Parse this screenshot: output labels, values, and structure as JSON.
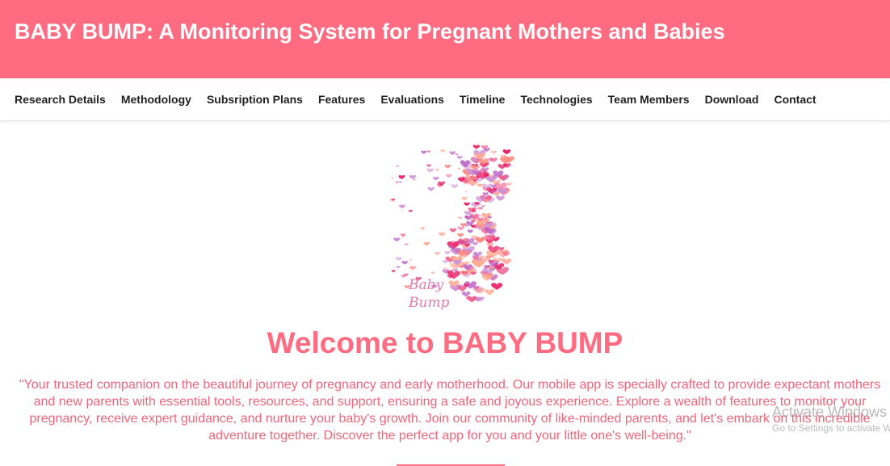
{
  "header": {
    "title": "BABY BUMP: A Monitoring System for Pregnant Mothers and Babies"
  },
  "nav": {
    "items": [
      {
        "label": "Research Details"
      },
      {
        "label": "Methodology"
      },
      {
        "label": "Subsription Plans"
      },
      {
        "label": "Features"
      },
      {
        "label": "Evaluations"
      },
      {
        "label": "Timeline"
      },
      {
        "label": "Technologies"
      },
      {
        "label": "Team Members"
      },
      {
        "label": "Download"
      },
      {
        "label": "Contact"
      }
    ]
  },
  "logo": {
    "line1": "Baby",
    "line2": "Bump",
    "colors": [
      "#f06292",
      "#ff8a80",
      "#ba68c8",
      "#e91e63",
      "#ffab91",
      "#ce93d8"
    ]
  },
  "main": {
    "welcome": "Welcome to BABY BUMP",
    "intro": "\"Your trusted companion on the beautiful journey of pregnancy and early motherhood. Our mobile app is specially crafted to provide expectant mothers and new parents with essential tools, resources, and support, ensuring a safe and joyous experience. Explore a wealth of features to monitor your pregnancy, receive expert guidance, and nurture your baby's growth. Join our community of like-minded parents, and let's embark on this incredible adventure together. Discover the perfect app for you and your little one's well-being.\""
  },
  "watermark": {
    "line1": "Activate Windows",
    "line2": "Go to Settings to activate Windows."
  },
  "theme": {
    "accent": "#ff6b81"
  }
}
